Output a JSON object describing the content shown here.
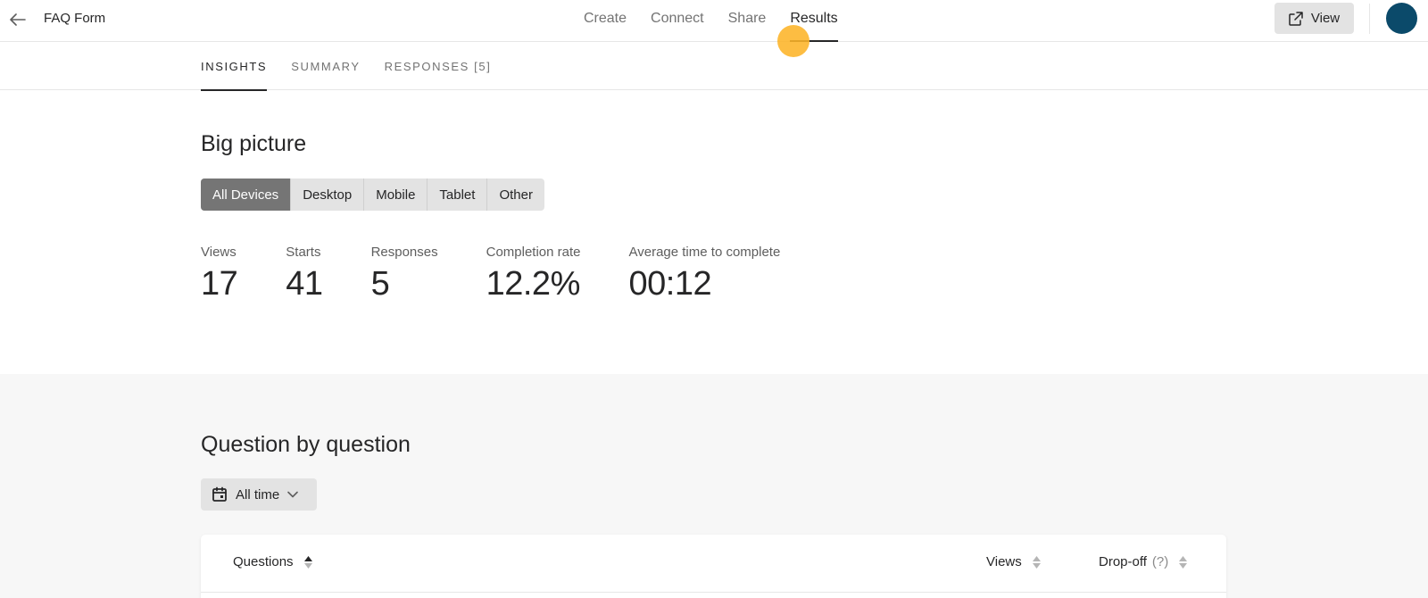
{
  "header": {
    "form_title": "FAQ Form",
    "nav": [
      {
        "label": "Create",
        "active": false
      },
      {
        "label": "Connect",
        "active": false
      },
      {
        "label": "Share",
        "active": false
      },
      {
        "label": "Results",
        "active": true
      }
    ],
    "view_label": "View",
    "icons": {
      "back": "arrow-left-icon",
      "view": "external-link-icon"
    }
  },
  "subnav": {
    "tabs": [
      {
        "label": "INSIGHTS",
        "active": true
      },
      {
        "label": "SUMMARY",
        "active": false
      },
      {
        "label": "RESPONSES [5]",
        "active": false
      }
    ]
  },
  "big_picture": {
    "title": "Big picture",
    "devices": [
      {
        "label": "All Devices",
        "active": true
      },
      {
        "label": "Desktop",
        "active": false
      },
      {
        "label": "Mobile",
        "active": false
      },
      {
        "label": "Tablet",
        "active": false
      },
      {
        "label": "Other",
        "active": false
      }
    ],
    "stats": [
      {
        "label": "Views",
        "value": "17"
      },
      {
        "label": "Starts",
        "value": "41"
      },
      {
        "label": "Responses",
        "value": "5"
      },
      {
        "label": "Completion rate",
        "value": "12.2%"
      },
      {
        "label": "Average time to complete",
        "value": "00:12"
      }
    ]
  },
  "question_by_question": {
    "title": "Question by question",
    "time_filter": "All time",
    "columns": {
      "questions": "Questions",
      "views": "Views",
      "dropoff": "Drop-off",
      "dropoff_hint": "(?)"
    }
  },
  "colors": {
    "avatar": "#0b4a6a",
    "cursor_highlight": "#fdb428",
    "active_segment": "#757575"
  }
}
